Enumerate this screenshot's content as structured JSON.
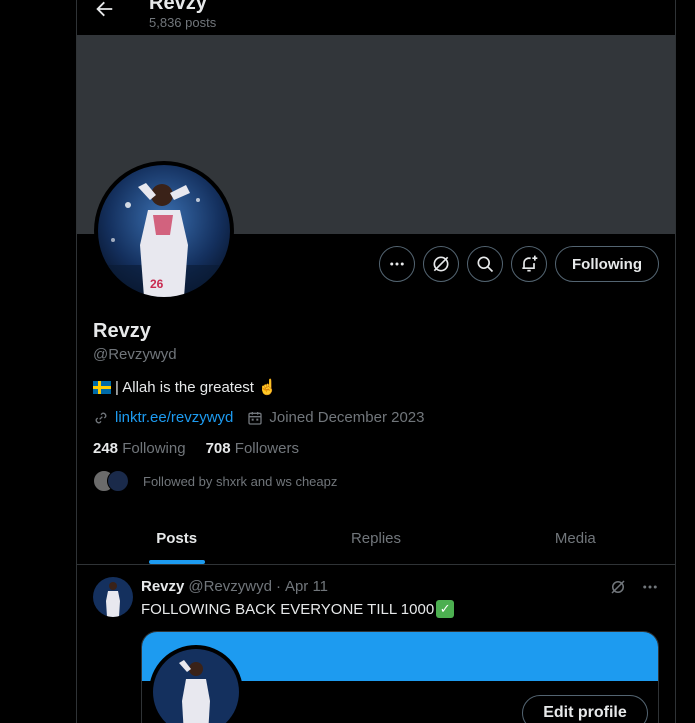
{
  "header": {
    "title": "Revzy",
    "post_count": "5,836 posts"
  },
  "profile": {
    "name": "Revzy",
    "handle": "@Revzywyd",
    "bio_text": "| Allah is the greatest ☝️",
    "link": "linktr.ee/revzywyd",
    "joined": "Joined December 2023",
    "following_count": "248",
    "following_label": "Following",
    "followers_count": "708",
    "followers_label": "Followers",
    "followed_by": "Followed by shxrk and ws cheapz",
    "follow_button": "Following"
  },
  "tabs": [
    {
      "label": "Posts",
      "active": true
    },
    {
      "label": "Replies",
      "active": false
    },
    {
      "label": "Media",
      "active": false
    }
  ],
  "post": {
    "author": "Revzy",
    "handle": "@Revzywyd",
    "separator": "·",
    "date": "Apr 11",
    "text": "FOLLOWING BACK EVERYONE TILL 1000",
    "check_glyph": "✓",
    "card_button": "Edit profile"
  },
  "colors": {
    "accent": "#1d9bf0",
    "banner": "#32363a",
    "border": "#2f3336",
    "muted": "#71767b"
  }
}
